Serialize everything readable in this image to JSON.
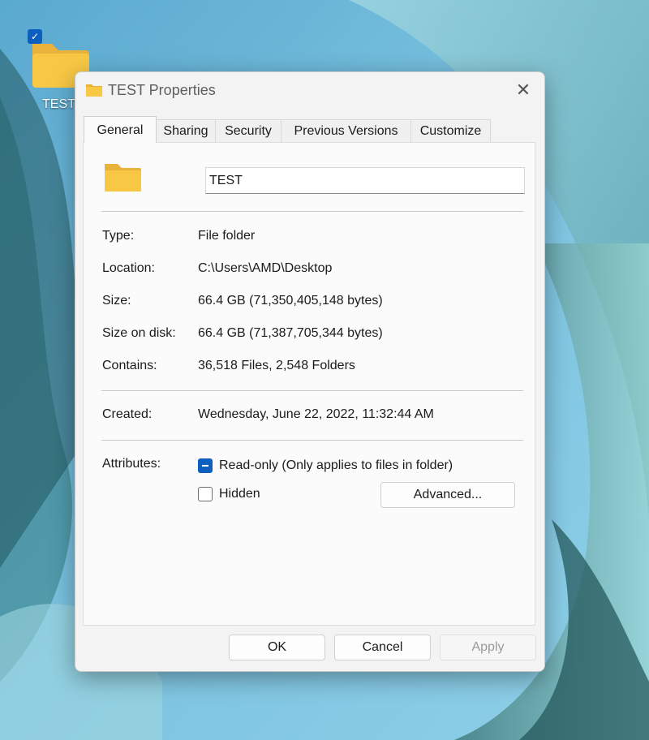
{
  "desktop": {
    "icon_label": "TEST",
    "icon_check": "✓"
  },
  "window": {
    "title": "TEST Properties",
    "close_glyph": "✕"
  },
  "tabs": [
    {
      "label": "General"
    },
    {
      "label": "Sharing"
    },
    {
      "label": "Security"
    },
    {
      "label": "Previous Versions"
    },
    {
      "label": "Customize"
    }
  ],
  "general": {
    "folder_name": "TEST",
    "rows": [
      {
        "label": "Type:",
        "value": "File folder"
      },
      {
        "label": "Location:",
        "value": "C:\\Users\\AMD\\Desktop"
      },
      {
        "label": "Size:",
        "value": "66.4 GB (71,350,405,148 bytes)"
      },
      {
        "label": "Size on disk:",
        "value": "66.4 GB (71,387,705,344 bytes)"
      },
      {
        "label": "Contains:",
        "value": "36,518 Files, 2,548 Folders"
      },
      {
        "label": "Created:",
        "value": "Wednesday, June 22, 2022, 11:32:44 AM"
      }
    ],
    "attributes_label": "Attributes:",
    "readonly_label": "Read-only (Only applies to files in folder)",
    "hidden_label": "Hidden",
    "advanced_label": "Advanced..."
  },
  "footer": {
    "ok_label": "OK",
    "cancel_label": "Cancel",
    "apply_label": "Apply"
  },
  "colors": {
    "accent": "#0d5fbf",
    "folder": "#f8c845"
  }
}
